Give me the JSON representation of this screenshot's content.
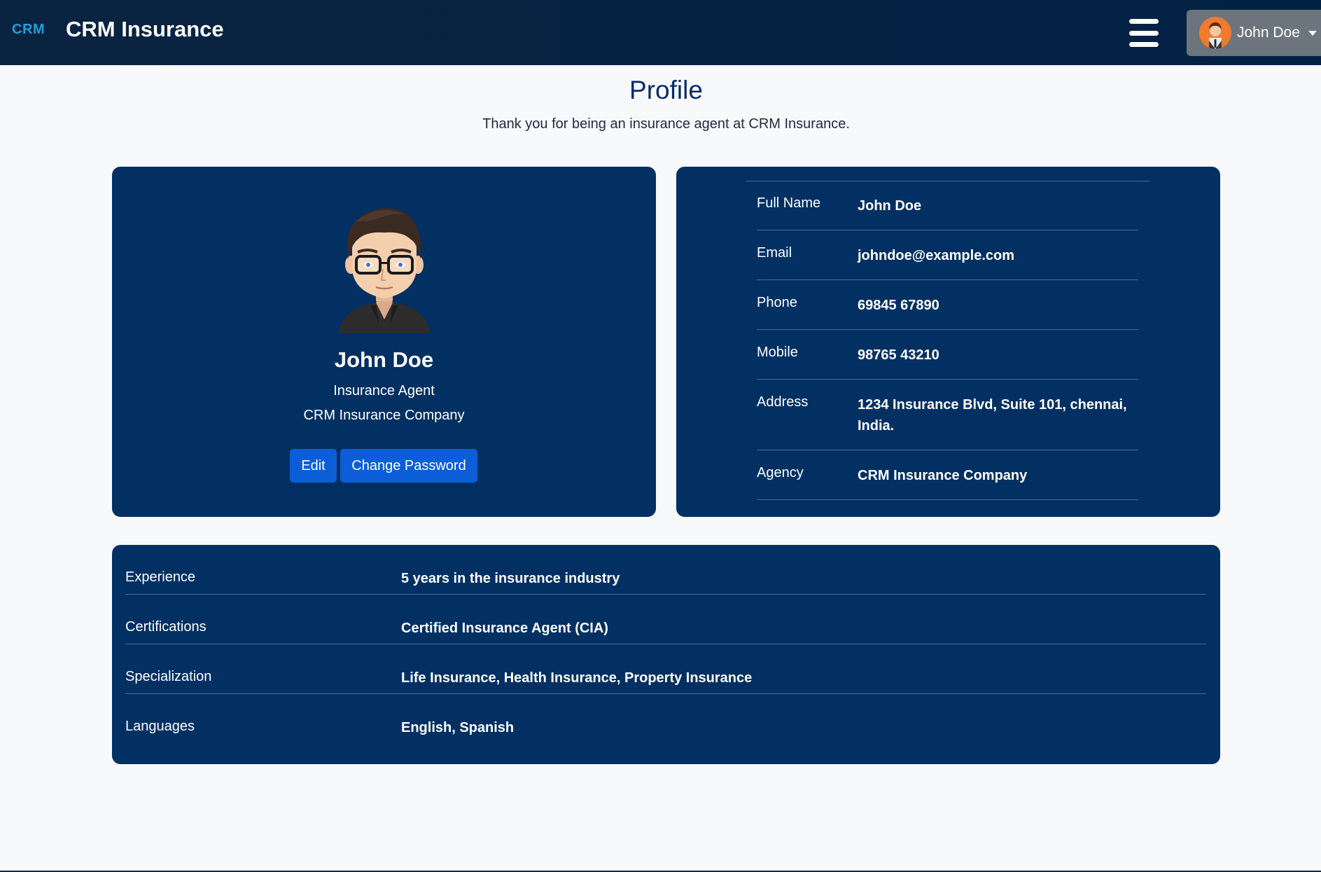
{
  "header": {
    "logo_text": "CRM",
    "app_title": "CRM Insurance",
    "user_name": "John Doe"
  },
  "page": {
    "title": "Profile",
    "subtitle": "Thank you for being an insurance agent at CRM Insurance."
  },
  "profile_card": {
    "name": "John Doe",
    "role": "Insurance Agent",
    "company": "CRM Insurance Company",
    "edit_label": "Edit",
    "change_password_label": "Change Password"
  },
  "details": [
    {
      "label": "Full Name",
      "value": "John Doe"
    },
    {
      "label": "Email",
      "value": "johndoe@example.com"
    },
    {
      "label": "Phone",
      "value": "69845 67890"
    },
    {
      "label": "Mobile",
      "value": "98765 43210"
    },
    {
      "label": "Address",
      "value": "1234 Insurance Blvd, Suite 101, chennai, India."
    },
    {
      "label": "Agency",
      "value": "CRM Insurance Company"
    }
  ],
  "professional": [
    {
      "label": "Experience",
      "value": "5 years in the insurance industry"
    },
    {
      "label": "Certifications",
      "value": "Certified Insurance Agent (CIA)"
    },
    {
      "label": "Specialization",
      "value": "Life Insurance, Health Insurance, Property Insurance"
    },
    {
      "label": "Languages",
      "value": "English, Spanish"
    }
  ],
  "icons": {
    "menu": "hamburger-icon",
    "dropdown": "caret-down-icon",
    "avatar": "user-avatar"
  },
  "colors": {
    "navbar": "#0a2340",
    "card": "#023063",
    "button": "#0b5ed7",
    "title": "#0b2a6e",
    "user_menu": "#6c757d"
  }
}
